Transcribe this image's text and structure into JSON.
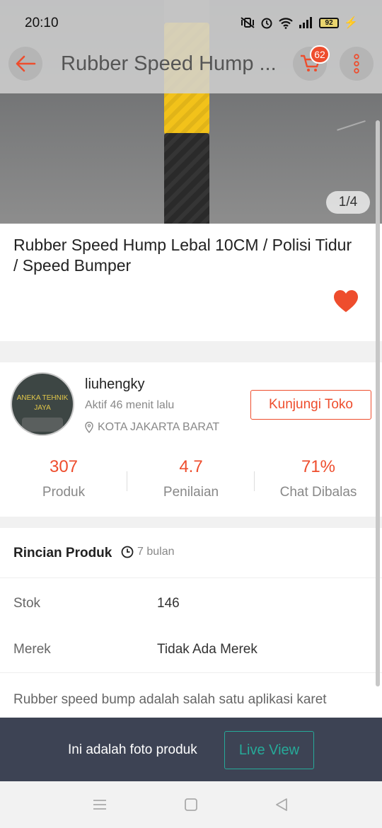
{
  "status_bar": {
    "time": "20:10",
    "battery": "92",
    "icons": [
      "mute-vibrate-icon",
      "alarm-icon",
      "wifi-icon",
      "signal-icon",
      "battery-icon",
      "charging-icon"
    ]
  },
  "app_bar": {
    "title": "Rubber Speed Hump ...",
    "cart_count": "62",
    "icons": [
      "back-arrow-icon",
      "cart-icon",
      "more-vertical-icon"
    ],
    "accent_color": "#ee4d2d"
  },
  "gallery": {
    "counter": "1/4"
  },
  "product": {
    "title": "Rubber Speed Hump Lebal 10CM / Polisi Tidur / Speed Bumper",
    "favorited": true
  },
  "shop": {
    "avatar_text": "ANEKA TEHNIK JAYA",
    "name": "liuhengky",
    "active_status": "Aktif 46 menit lalu",
    "location": "KOTA JAKARTA BARAT",
    "visit_label": "Kunjungi Toko",
    "stats": [
      {
        "value": "307",
        "label": "Produk"
      },
      {
        "value": "4.7",
        "label": "Penilaian"
      },
      {
        "value": "71%",
        "label": "Chat Dibalas"
      }
    ]
  },
  "details": {
    "heading": "Rincian Produk",
    "time_ago": "7 bulan",
    "rows": [
      {
        "key": "Stok",
        "value": "146"
      },
      {
        "key": "Merek",
        "value": "Tidak Ada Merek"
      }
    ],
    "description": "Rubber speed bump adalah salah satu aplikasi karet"
  },
  "live_banner": {
    "message": "Ini adalah foto produk",
    "button_label": "Live View",
    "button_color": "#26aa99"
  },
  "nav_bar": {
    "icons": [
      "menu-icon",
      "home-square-icon",
      "back-triangle-icon"
    ]
  }
}
